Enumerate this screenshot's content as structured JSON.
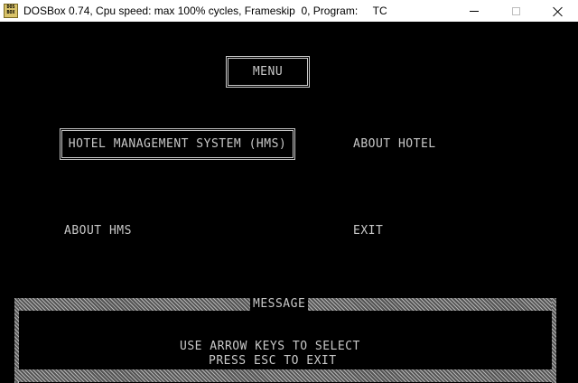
{
  "window": {
    "icon_text": "DOS BOX",
    "title": "DOSBox 0.74, Cpu speed: max 100% cycles, Frameskip  0, Program:     TC"
  },
  "icons": {
    "app": "dosbox-icon",
    "minimize": "minimize-icon",
    "maximize": "maximize-icon",
    "close": "close-icon"
  },
  "menu": {
    "title": "MENU",
    "items": [
      {
        "label": "HOTEL MANAGEMENT SYSTEM (HMS)",
        "selected": true
      },
      {
        "label": "ABOUT HOTEL",
        "selected": false
      },
      {
        "label": "ABOUT HMS",
        "selected": false
      },
      {
        "label": "EXIT",
        "selected": false
      }
    ]
  },
  "message": {
    "label": "MESSAGE",
    "lines": [
      "USE ARROW KEYS TO SELECT",
      "PRESS ESC TO EXIT"
    ]
  },
  "colors": {
    "screen_bg": "#000000",
    "text": "#c8c8c8",
    "titlebar_bg": "#ffffff"
  }
}
